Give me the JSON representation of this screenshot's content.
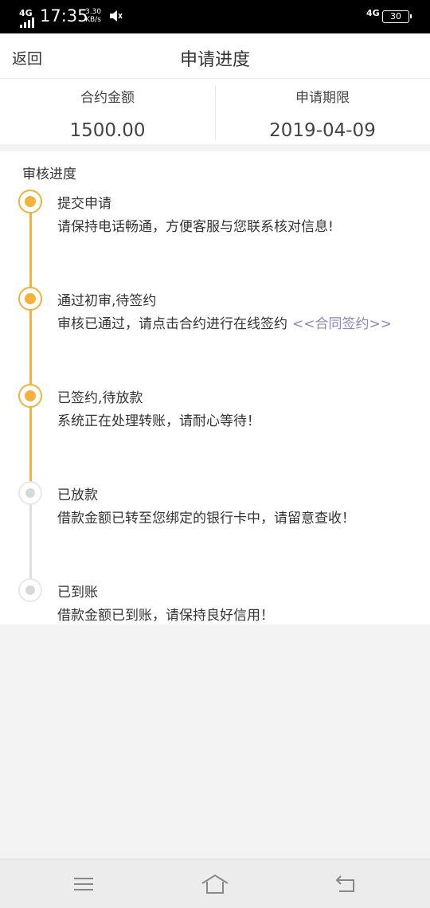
{
  "status_bar": {
    "network_left": "4G",
    "time": "17:35",
    "speed_value": "3.30",
    "speed_unit": "KB/s",
    "network_right": "4G",
    "battery": "30"
  },
  "header": {
    "back_label": "返回",
    "title": "申请进度"
  },
  "summary": {
    "amount_label": "合约金额",
    "amount_value": "1500.00",
    "deadline_label": "申请期限",
    "deadline_value": "2019-04-09"
  },
  "progress": {
    "section_title": "审核进度",
    "steps": [
      {
        "title": "提交申请",
        "desc": "请保持电话畅通，方便客服与您联系核对信息!",
        "state": "active"
      },
      {
        "title": "通过初审,待签约",
        "desc": "审核已通过，请点击合约进行在线签约",
        "link": "<<合同签约>>",
        "state": "active"
      },
      {
        "title": "已签约,待放款",
        "desc": "系统正在处理转账，请耐心等待！",
        "state": "active"
      },
      {
        "title": "已放款",
        "desc": "借款金额已转至您绑定的银行卡中，请留意查收！",
        "state": "pending"
      },
      {
        "title": "已到账",
        "desc": "借款金额已到账，请保持良好信用！",
        "state": "pending"
      }
    ]
  },
  "colors": {
    "accent": "#f5b13b",
    "pending": "#d8d8d8",
    "link": "#8a86c0"
  },
  "nav": {
    "menu_icon": "menu-icon",
    "home_icon": "home-icon",
    "back_icon": "back-arrow-icon"
  }
}
